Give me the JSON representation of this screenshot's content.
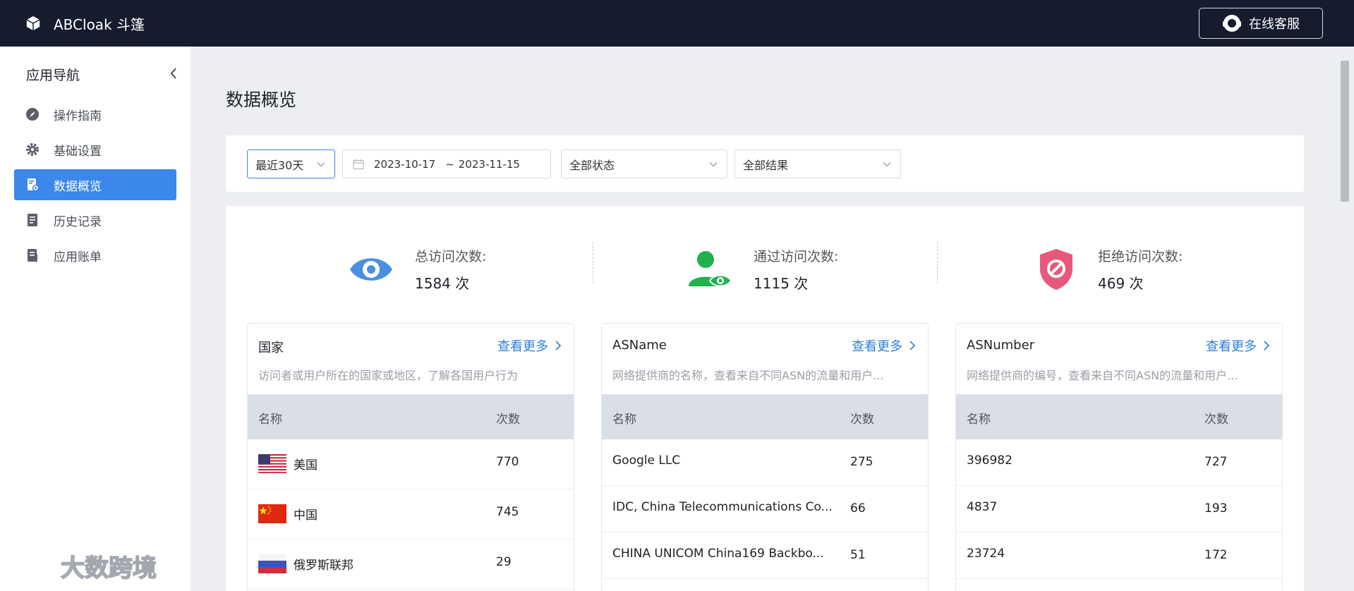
{
  "app": {
    "name": "ABCloak 斗篷",
    "support_label": "在线客服"
  },
  "sidebar": {
    "title": "应用导航",
    "items": [
      {
        "label": "操作指南",
        "icon": "compass-icon"
      },
      {
        "label": "基础设置",
        "icon": "gear-icon"
      },
      {
        "label": "数据概览",
        "icon": "data-report-icon",
        "active": true
      },
      {
        "label": "历史记录",
        "icon": "document-icon"
      },
      {
        "label": "应用账单",
        "icon": "bill-icon"
      }
    ]
  },
  "main": {
    "title": "数据概览",
    "filters": {
      "range": "最近30天",
      "date_start": "2023-10-17",
      "date_sep": "~",
      "date_end": "2023-11-15",
      "status": "全部状态",
      "result": "全部结果"
    },
    "stats": [
      {
        "label": "总访问次数:",
        "value": "1584 次",
        "icon": "eye-icon",
        "color": "#4a90e2"
      },
      {
        "label": "通过访问次数:",
        "value": "1115 次",
        "icon": "user-check-icon",
        "color": "#22b14c"
      },
      {
        "label": "拒绝访问次数:",
        "value": "469 次",
        "icon": "shield-block-icon",
        "color": "#e8587a"
      }
    ],
    "panels": [
      {
        "title": "国家",
        "more": "查看更多",
        "desc": "访问者或用户所在的国家或地区，了解各国用户行为",
        "col_name": "名称",
        "col_count": "次数",
        "rows": [
          {
            "name": "美国",
            "count": "770",
            "flag": "us"
          },
          {
            "name": "中国",
            "count": "745",
            "flag": "cn"
          },
          {
            "name": "俄罗斯联邦",
            "count": "29",
            "flag": "ru"
          }
        ]
      },
      {
        "title": "ASName",
        "more": "查看更多",
        "desc": "网络提供商的名称，查看来自不同ASN的流量和用户...",
        "col_name": "名称",
        "col_count": "次数",
        "rows": [
          {
            "name": "Google LLC",
            "count": "275"
          },
          {
            "name": "IDC, China Telecommunications Co...",
            "count": "66"
          },
          {
            "name": "CHINA UNICOM China169 Backbo...",
            "count": "51"
          }
        ]
      },
      {
        "title": "ASNumber",
        "more": "查看更多",
        "desc": "网络提供商的编号，查看来自不同ASN的流量和用户...",
        "col_name": "名称",
        "col_count": "次数",
        "rows": [
          {
            "name": "396982",
            "count": "727"
          },
          {
            "name": "4837",
            "count": "193"
          },
          {
            "name": "23724",
            "count": "172"
          }
        ]
      }
    ]
  },
  "watermark": "大数跨境"
}
